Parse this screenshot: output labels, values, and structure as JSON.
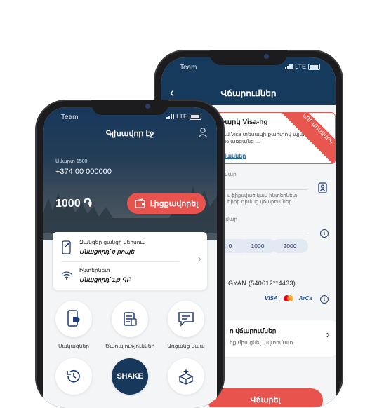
{
  "back_phone": {
    "status": {
      "carrier": "Team",
      "network": "LTE"
    },
    "header": {
      "title": "Վճարումներ"
    },
    "offer": {
      "title": "ւշարկ Visa-hg",
      "description": "ւում Visa տեսակի քարտով պյալ 15% առցանց ...",
      "link": "յմաններ",
      "ribbon": "ՆՈՐ ԱՌԱՋԱՐԿ"
    },
    "fields": {
      "phone_label": "մար",
      "phone_note": "ւ ֆիքսված կամ ինտերնետ\nհիրի դիմաց վճարումներ",
      "amount_label": "ւմար",
      "amount_options": [
        "0",
        "1000",
        "2000"
      ],
      "account": "GYAN (540612**4433)",
      "payment_logos": [
        "VISA",
        "ArCa"
      ]
    },
    "auto_payments": {
      "title": "ո վճարումներ",
      "description": "եք միացնել ավտոմատ"
    },
    "submit_button": "Վճարել"
  },
  "front_phone": {
    "status": {
      "carrier": "Team",
      "network": "LTE"
    },
    "header": {
      "title": "Գլխավոր էջ"
    },
    "account": {
      "plan": "Ամարտ 1500",
      "number": "+374 00 000000",
      "balance": "1000 ֏"
    },
    "topup_button": "Լիցքավորել",
    "usage": [
      {
        "label": "Զանգեր ցանցի ներսում",
        "value": "Մնացորդ՝ 0 րոպե"
      },
      {
        "label": "Ինտերնետ",
        "value": "Մնացորդ՝ 1,9 ԳԲ"
      }
    ],
    "tiles": [
      {
        "label": "Սակագներ",
        "icon": "phone-tag-icon"
      },
      {
        "label": "Ծառայություններ",
        "icon": "services-icon"
      },
      {
        "label": "Առցանց կապ",
        "icon": "chat-icon"
      },
      {
        "label": "",
        "icon": "history-icon"
      },
      {
        "label": "SHAKE",
        "icon": "shake-logo"
      },
      {
        "label": "",
        "icon": "gift-box-icon"
      }
    ]
  },
  "colors": {
    "brand": "#17375b",
    "accent": "#e8534e",
    "link": "#1f5fa8"
  }
}
